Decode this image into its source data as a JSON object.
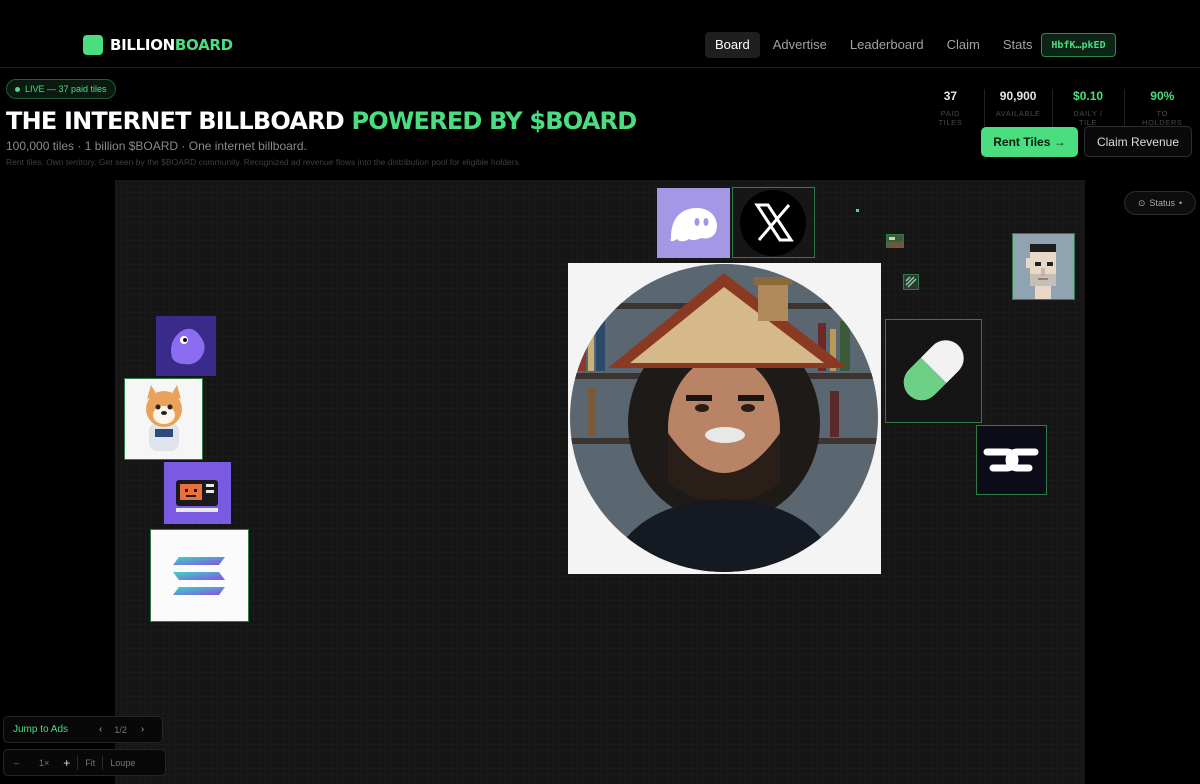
{
  "nav": {
    "logo_part1": "BILLION",
    "logo_part2": "BOARD",
    "links": [
      "Board",
      "Advertise",
      "Leaderboard",
      "Claim",
      "Stats"
    ],
    "active_link": "Board",
    "wallet": "HbfK…pkED"
  },
  "hero": {
    "live": "LIVE — 37 paid tiles",
    "title_white": "THE INTERNET BILLBOARD",
    "title_green": "POWERED BY $BOARD",
    "subtitle": "100,000 tiles · 1 billion $BOARD · One internet billboard.",
    "description": "Rent tiles. Own territory. Get seen by the $BOARD community. Recognized ad revenue flows into the distribution pool for eligible holders."
  },
  "stats": [
    {
      "value": "37",
      "label": "PAID TILES"
    },
    {
      "value": "90,900",
      "label": "AVAILABLE"
    },
    {
      "value": "$0.10",
      "label": "DAILY / TILE"
    },
    {
      "value": "90%",
      "label": "TO HOLDERS"
    }
  ],
  "actions": {
    "rent": "Rent Tiles →",
    "claim": "Claim Revenue"
  },
  "board": {
    "status": "Status",
    "jump": "Jump to Ads",
    "page": "1/2",
    "zoom_minus": "–",
    "zoom_level": "1×",
    "zoom_plus": "+",
    "fit": "Fit",
    "loupe": "Loupe"
  },
  "colors": {
    "accent": "#4ade80",
    "background": "#000000",
    "board": "#151515"
  },
  "icons": [
    "ghost-icon",
    "x-logo-icon",
    "pixel-punk-icon",
    "pill-icon",
    "monogram-logo-icon",
    "mascot-icon",
    "shiba-astronaut-icon",
    "retro-computer-icon",
    "solana-logo-icon",
    "status-icon"
  ]
}
